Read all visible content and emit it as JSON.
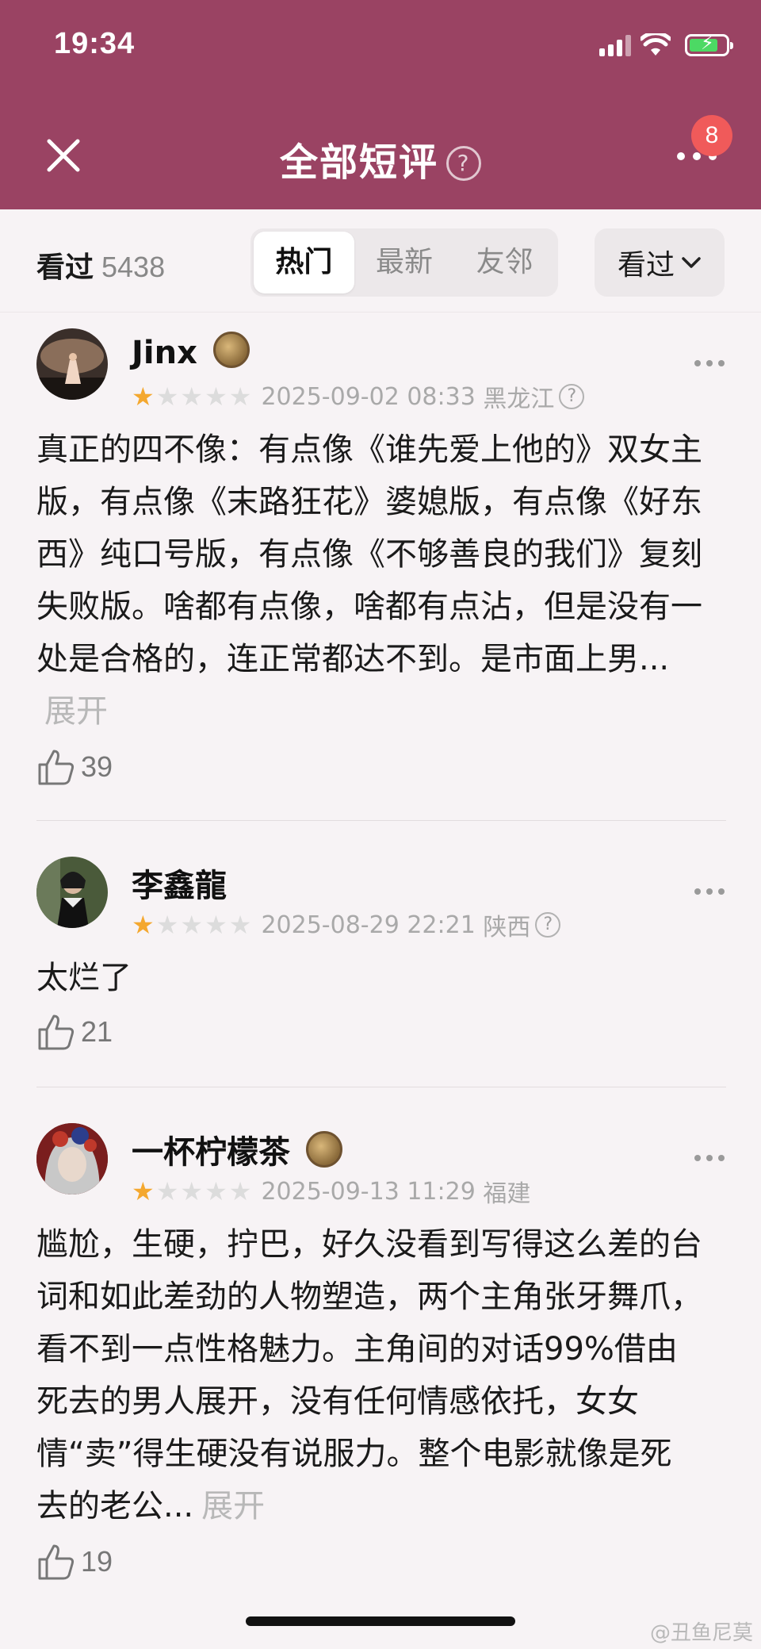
{
  "status_bar": {
    "time": "19:34"
  },
  "nav": {
    "title": "全部短评",
    "help": "?",
    "badge": "8"
  },
  "filter": {
    "seen_label": "看过",
    "seen_count": "5438",
    "tabs": [
      {
        "label": "热门",
        "active": true
      },
      {
        "label": "最新",
        "active": false
      },
      {
        "label": "友邻",
        "active": false
      }
    ],
    "dropdown_label": "看过"
  },
  "comments": [
    {
      "user": "Jinx",
      "has_medal": true,
      "rating": 1,
      "time": "2025-09-02 08:33",
      "location": "黑龙江",
      "show_help": true,
      "text": "真正的四不像：有点像《谁先爱上他的》双女主版，有点像《末路狂花》婆媳版，有点像《好东西》纯口号版，有点像《不够善良的我们》复刻失败版。啥都有点像，啥都有点沾，但是没有一处是合格的，连正常都达不到。是市面上男...",
      "expand": "展开",
      "likes": "39"
    },
    {
      "user": "李鑫龍",
      "has_medal": false,
      "rating": 1,
      "time": "2025-08-29 22:21",
      "location": "陕西",
      "show_help": true,
      "text": "太烂了",
      "expand": "",
      "likes": "21"
    },
    {
      "user": "一杯柠檬茶",
      "has_medal": true,
      "rating": 1,
      "time": "2025-09-13 11:29",
      "location": "福建",
      "show_help": false,
      "text": "尴尬，生硬，拧巴，好久没看到写得这么差的台词和如此差劲的人物塑造，两个主角张牙舞爪，看不到一点性格魅力。主角间的对话99%借由死去的男人展开，没有任何情感依托，女女情“卖”得生硬没有说服力。整个电影就像是死去的老公...",
      "expand": "展开",
      "likes": "19"
    }
  ],
  "watermark": "@丑鱼尼莫",
  "colors": {
    "header": "#9a4363",
    "star": "#f4a82f",
    "badge": "#f05a5a"
  }
}
